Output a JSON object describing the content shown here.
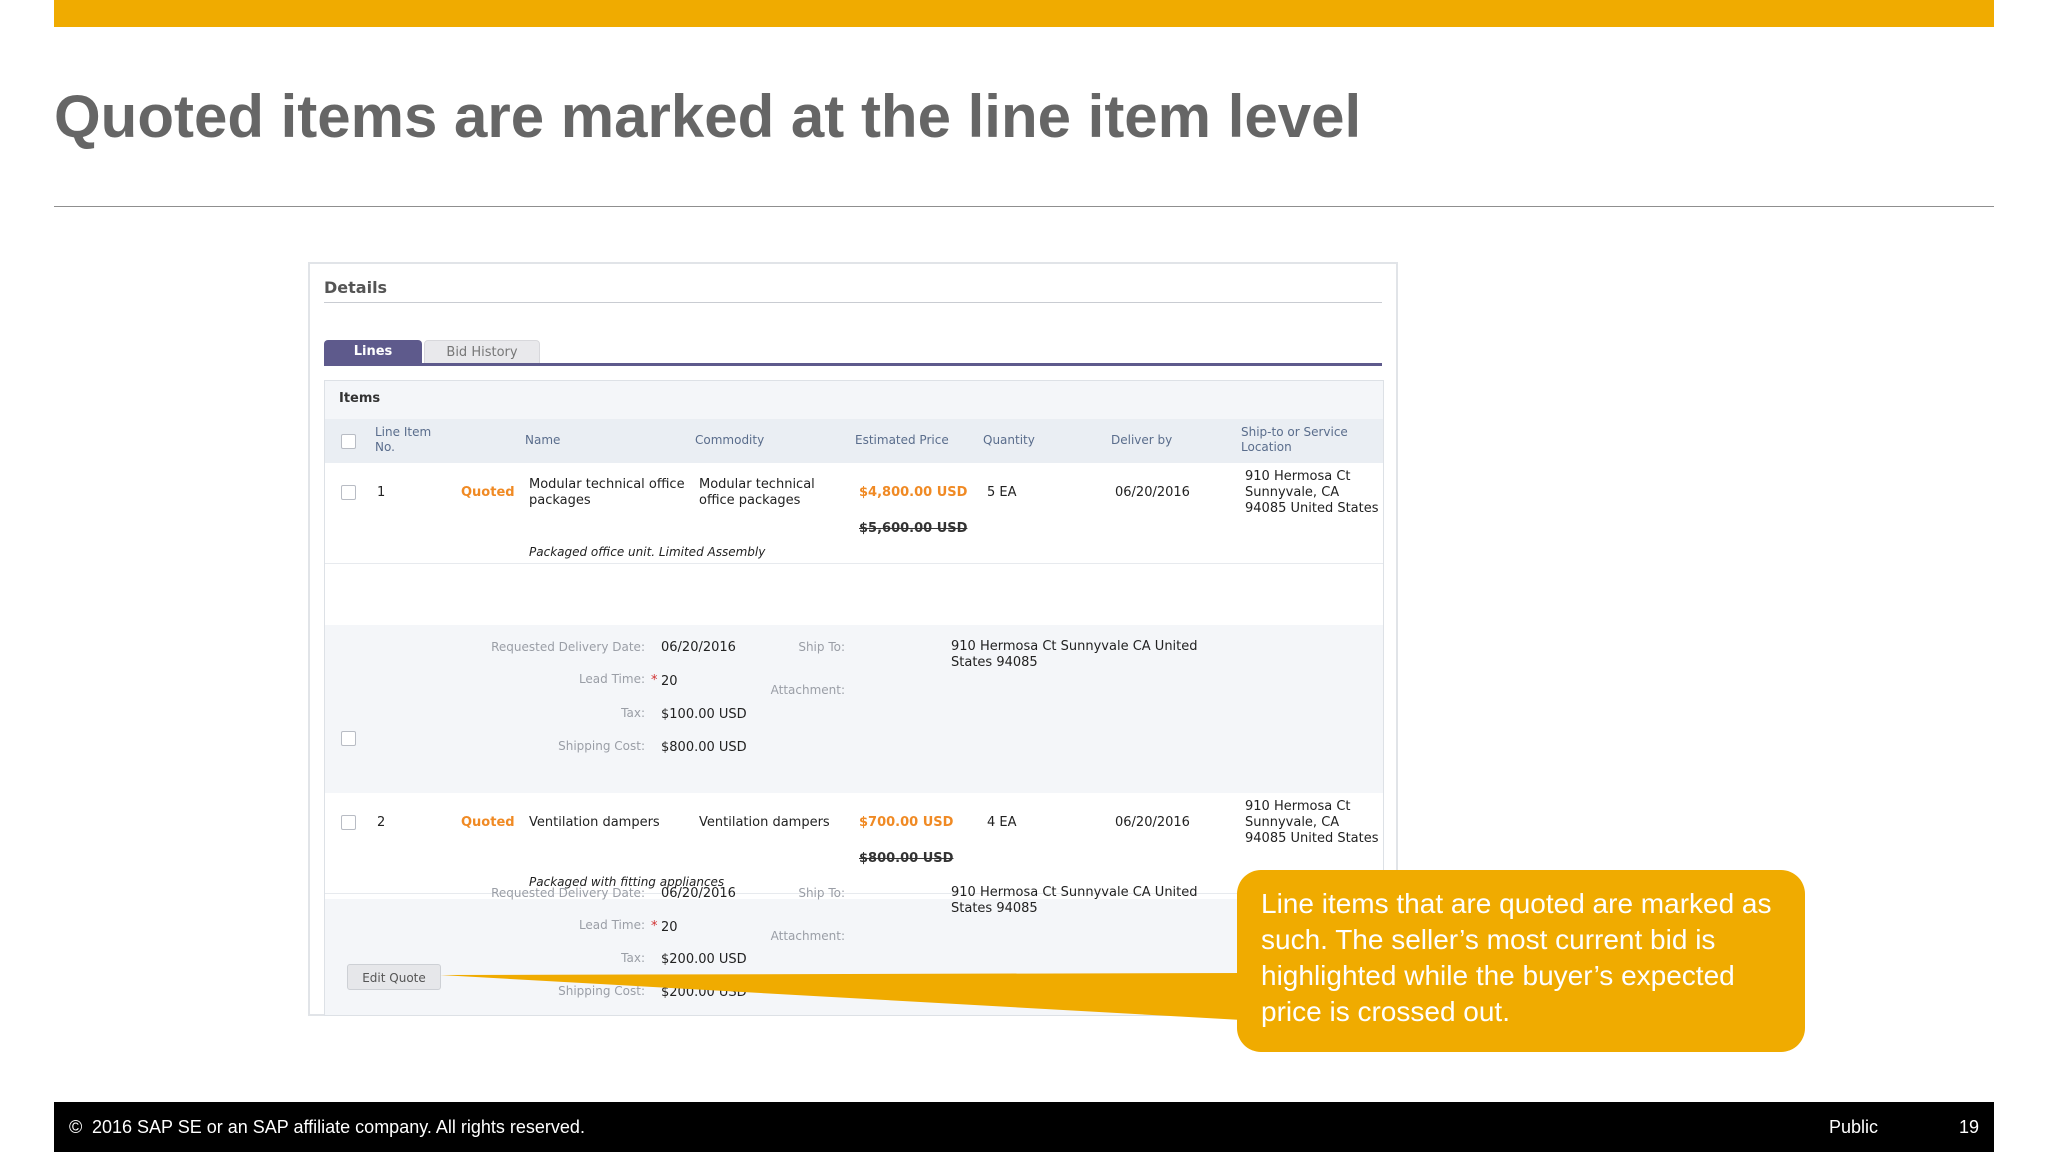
{
  "slide": {
    "title": "Quoted items are marked at the line item level",
    "callout": "Line items that are quoted are marked as such. The seller’s most current bid is highlighted while the buyer’s expected price is crossed out.",
    "copyright_icon": "©",
    "copyright": "2016 SAP SE or an SAP affiliate company. All rights reserved.",
    "classification": "Public",
    "page_number": "19",
    "colors": {
      "accent": "#f0ab00",
      "title": "#666666",
      "quoted": "#f08a24",
      "tab_active": "#5e5a8c"
    }
  },
  "details": {
    "title": "Details",
    "tabs": [
      {
        "label": "Lines",
        "active": true
      },
      {
        "label": "Bid History",
        "active": false
      }
    ],
    "items_title": "Items",
    "columns": [
      "Line Item No.",
      "Name",
      "Commodity",
      "Estimated Price",
      "Quantity",
      "Deliver by",
      "Ship-to or Service Location"
    ],
    "rows": [
      {
        "no": "1",
        "status": "Quoted",
        "name": "Modular technical office packages",
        "commodity": "Modular technical office packages",
        "price": "$4,800.00 USD",
        "original_price": "$5,600.00 USD",
        "quantity": "5 EA",
        "deliver_by": "06/20/2016",
        "location": "910 Hermosa Ct Sunnyvale, CA 94085 United States",
        "description": "Packaged office unit. Limited Assembly",
        "requested_delivery_label": "Requested Delivery Date:",
        "requested_delivery": "06/20/2016",
        "lead_time_label": "Lead Time:",
        "lead_time": "20",
        "tax_label": "Tax:",
        "tax": "$100.00 USD",
        "shipping_label": "Shipping Cost:",
        "shipping": "$800.00 USD",
        "ship_to_label": "Ship To:",
        "ship_to": "910 Hermosa Ct Sunnyvale CA United States 94085",
        "attachment_label": "Attachment:"
      },
      {
        "no": "2",
        "status": "Quoted",
        "name": "Ventilation dampers",
        "commodity": "Ventilation dampers",
        "price": "$700.00 USD",
        "original_price": "$800.00 USD",
        "quantity": "4 EA",
        "deliver_by": "06/20/2016",
        "location": "910 Hermosa Ct Sunnyvale, CA 94085 United States",
        "description": "Packaged with fitting appliances",
        "requested_delivery_label": "Requested Delivery Date:",
        "requested_delivery": "06/20/2016",
        "lead_time_label": "Lead Time:",
        "lead_time": "20",
        "tax_label": "Tax:",
        "tax": "$200.00 USD",
        "shipping_label": "Shipping Cost:",
        "shipping": "$200.00 USD",
        "ship_to_label": "Ship To:",
        "ship_to": "910 Hermosa Ct Sunnyvale CA United States 94085",
        "attachment_label": "Attachment:"
      }
    ],
    "edit_quote_label": "Edit Quote"
  }
}
